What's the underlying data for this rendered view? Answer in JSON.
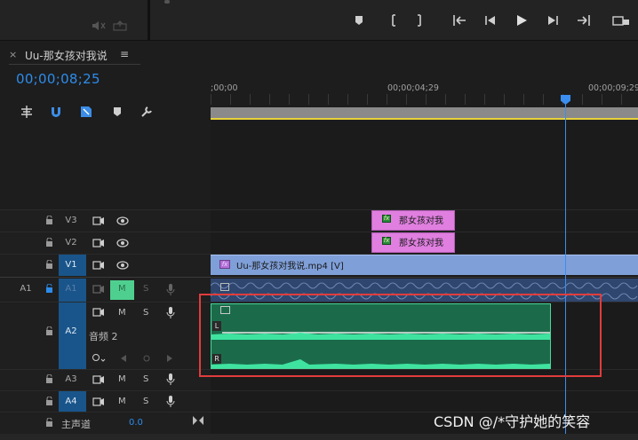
{
  "sequence": {
    "tab_close": "×",
    "name": "Uu-那女孩对我说",
    "menu": "≡",
    "timecode": "00;00;08;25"
  },
  "ruler": {
    "labels": [
      ";00;00",
      "00;00;04;29",
      "00;00;09;29"
    ]
  },
  "tracks": {
    "V3": {
      "name": "V3",
      "clip": "那女孩对我"
    },
    "V2": {
      "name": "V2",
      "clip": "那女孩对我"
    },
    "V1": {
      "name": "V1",
      "clip": "Uu-那女孩对我说.mp4 [V]"
    },
    "A1": {
      "name": "A1",
      "source": "A1",
      "m": "M",
      "s": "S"
    },
    "A2": {
      "name": "A2",
      "label": "音频 2",
      "m": "M",
      "s": "S",
      "L": "L",
      "R": "R"
    },
    "A3": {
      "name": "A3",
      "m": "M",
      "s": "S"
    },
    "A4": {
      "name": "A4",
      "m": "M",
      "s": "S"
    }
  },
  "master": {
    "label": "主声道",
    "value": "0.0"
  },
  "fx_badge": "fx",
  "watermark": "CSDN @/*守护她的笑容",
  "colors": {
    "accent_blue": "#2d8ceb",
    "playhead": "#3b8ef0",
    "video_clip": "#7f9fd8",
    "title_clip": "#e07fe0",
    "audio_clip": "#1b6b4b",
    "highlight_box": "#e23c3c",
    "track_target": "#19558a"
  }
}
